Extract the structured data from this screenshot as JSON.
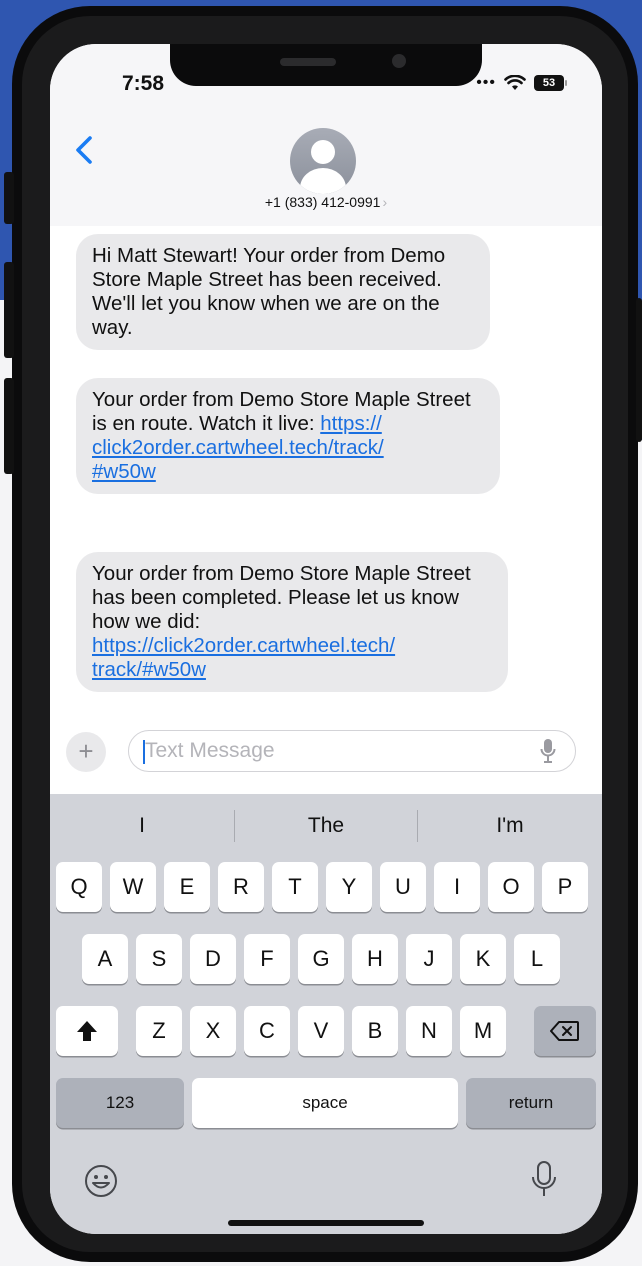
{
  "status_bar": {
    "time": "7:58",
    "battery": "53"
  },
  "header": {
    "contact_number": "+1 (833) 412-0991",
    "chevron": "›"
  },
  "messages": [
    {
      "text": "Hi Matt Stewart! Your order from Demo Store Maple  Street has been received. We'll let you know when we are on the way."
    },
    {
      "text_before": "Your order from Demo Store  Maple Street  is en route. Watch it live: ",
      "link_line1": "https://",
      "link_line2": "click2order.cartwheel.tech/track/",
      "link_line3": "#w50w"
    },
    {
      "text_before": "Your order from Demo Store  Maple Street  has been completed. Please let us know how we did: ",
      "link_line1": "https://click2order.cartwheel.tech/",
      "link_line2": "track/#w50w"
    }
  ],
  "composer": {
    "placeholder": "Text Message",
    "plus": "+"
  },
  "keyboard": {
    "suggestions": [
      "I",
      "The",
      "I'm"
    ],
    "row1": [
      "Q",
      "W",
      "E",
      "R",
      "T",
      "Y",
      "U",
      "I",
      "O",
      "P"
    ],
    "row2": [
      "A",
      "S",
      "D",
      "F",
      "G",
      "H",
      "J",
      "K",
      "L"
    ],
    "row3": [
      "Z",
      "X",
      "C",
      "V",
      "B",
      "N",
      "M"
    ],
    "numbers_label": "123",
    "space_label": "space",
    "return_label": "return"
  },
  "colors": {
    "link": "#1a6fe0",
    "bubble": "#e9e9eb",
    "background_blue": "#2f56b0"
  }
}
